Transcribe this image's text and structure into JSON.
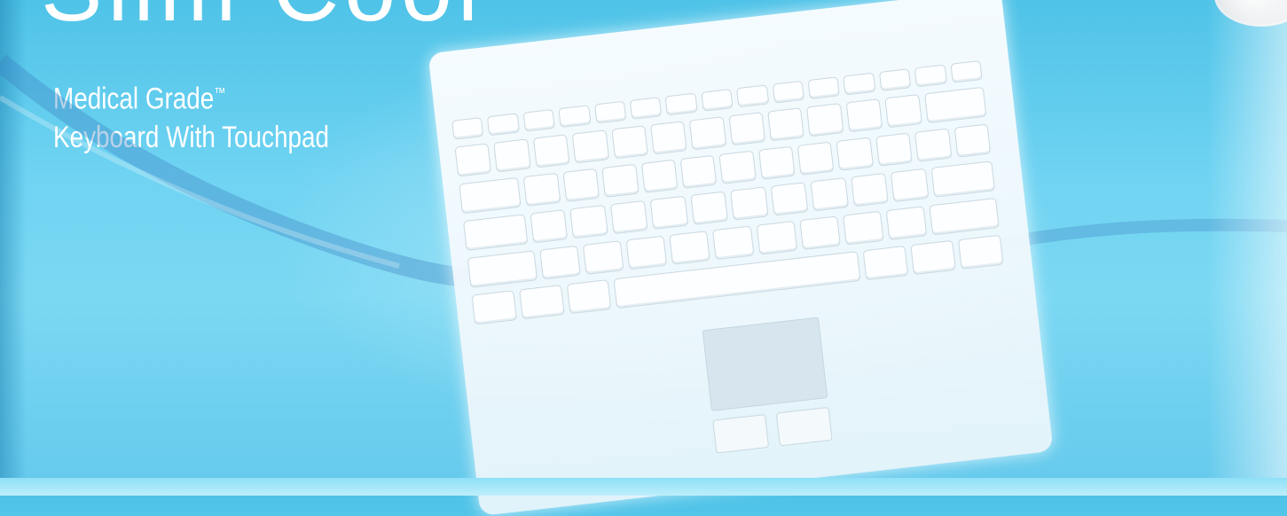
{
  "header": {
    "title_partial": "Slim Cool",
    "subtitle_line1": "Medical Grade",
    "trademark": "™",
    "subtitle_line2": "Keyboard With Touchpad"
  },
  "image": {
    "subject": "white-keyboard-with-touchpad",
    "background": "water-splash",
    "colors": {
      "sky": "#6fd3f2",
      "text": "#ffffff",
      "splash": "#2f55a8"
    }
  }
}
